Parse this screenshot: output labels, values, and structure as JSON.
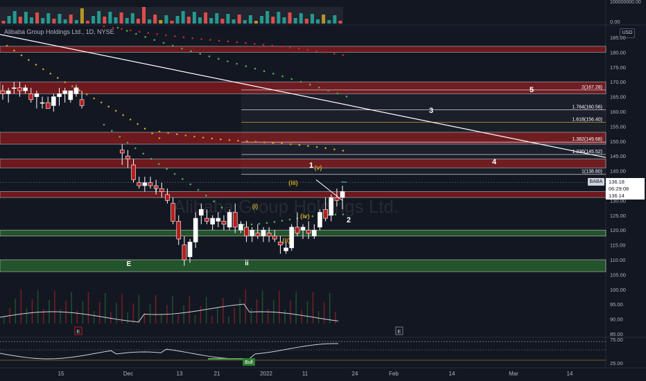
{
  "symbol_legend": "Alibaba Group Holdings Ltd., 1D, NYSE",
  "watermark": "Alibaba Group Holdings Ltd.",
  "watermark_ticker": "BABA",
  "currency": "USD",
  "price_scale": {
    "labels": [
      "185.00",
      "180.00",
      "175.00",
      "170.00",
      "165.00",
      "160.00",
      "155.00",
      "150.00",
      "145.00",
      "140.00",
      "135.00",
      "130.00",
      "125.00",
      "120.00",
      "115.00",
      "110.00",
      "105.00",
      "100.00",
      "95.00",
      "90.00",
      "85.00"
    ],
    "volume_top_label": "100000000.00",
    "volume_bottom_label": "0.00",
    "rsi_labels": [
      "75.00",
      "25.00"
    ]
  },
  "price_tags": {
    "ticker": "BABA",
    "last_price": "136.18",
    "countdown": "06:29:08",
    "second_price": "136.14"
  },
  "time_axis": [
    "15",
    "Dec",
    "13",
    "21",
    "2022",
    "11",
    "24",
    "Feb",
    "14",
    "Mar",
    "14"
  ],
  "fib_levels": [
    "2(167.28)",
    "1.764(160.56)",
    "1.618(156.40)",
    "1.382(149.68)",
    "1.236(145.52)",
    "1(138.80)"
  ],
  "wave_labels": {
    "major": [
      "3",
      "5",
      "4",
      "2",
      "1"
    ],
    "minor": [
      "i",
      "ii",
      "E"
    ],
    "sub": [
      "(i)",
      "(ii)",
      "(iii)",
      "(iv)",
      "(v)"
    ]
  },
  "event_markers": [
    "E",
    "E"
  ],
  "signal_label": "Bull",
  "chart_data": {
    "type": "candlestick",
    "symbol": "BABA",
    "exchange": "NYSE",
    "interval": "1D",
    "ylim": [
      85,
      185
    ],
    "candles": [
      [
        167,
        169,
        164,
        166
      ],
      [
        166,
        168,
        163,
        167
      ],
      [
        168,
        170,
        166,
        168
      ],
      [
        168,
        170,
        165,
        167
      ],
      [
        167,
        169,
        166,
        168
      ],
      [
        166,
        168,
        163,
        164
      ],
      [
        165,
        167,
        161,
        166
      ],
      [
        163,
        165,
        161,
        163
      ],
      [
        163,
        165,
        161,
        161
      ],
      [
        162,
        166,
        160,
        165
      ],
      [
        165,
        168,
        162,
        166
      ],
      [
        166,
        168,
        163,
        167
      ],
      [
        164,
        167,
        163,
        167
      ],
      [
        166,
        169,
        165,
        168
      ],
      [
        164,
        167,
        161,
        162
      ],
      [
        147,
        149,
        142,
        146
      ],
      [
        145,
        147,
        141,
        144
      ],
      [
        142,
        144,
        136,
        137
      ],
      [
        136,
        138,
        134,
        135
      ],
      [
        135,
        138,
        133,
        136
      ],
      [
        136,
        138,
        134,
        135
      ],
      [
        135,
        137,
        132,
        134
      ],
      [
        134,
        136,
        131,
        133
      ],
      [
        132,
        134,
        129,
        130
      ],
      [
        129,
        131,
        122,
        123
      ],
      [
        123,
        125,
        115,
        117
      ],
      [
        115,
        118,
        108,
        110
      ],
      [
        111,
        117,
        109,
        116
      ],
      [
        116,
        126,
        114,
        124
      ],
      [
        125,
        129,
        122,
        127
      ],
      [
        124,
        127,
        122,
        123
      ],
      [
        122,
        125,
        120,
        124
      ],
      [
        123,
        126,
        121,
        124
      ],
      [
        123,
        125,
        120,
        122
      ],
      [
        121,
        127,
        120,
        126
      ],
      [
        126,
        129,
        119,
        121
      ],
      [
        120,
        123,
        119,
        122
      ],
      [
        121,
        123,
        116,
        118
      ],
      [
        118,
        121,
        116,
        120
      ],
      [
        119,
        122,
        117,
        118
      ],
      [
        118,
        121,
        116,
        120
      ],
      [
        119,
        121,
        116,
        118
      ],
      [
        118,
        120,
        116,
        117
      ],
      [
        116,
        118,
        112,
        115
      ],
      [
        113,
        116,
        112,
        114
      ],
      [
        114,
        122,
        113,
        121
      ],
      [
        121,
        126,
        118,
        119
      ],
      [
        120,
        122,
        117,
        121
      ],
      [
        120,
        123,
        117,
        119
      ],
      [
        118,
        122,
        117,
        120
      ],
      [
        121,
        127,
        120,
        126
      ],
      [
        127,
        131,
        123,
        124
      ],
      [
        125,
        132,
        123,
        131
      ],
      [
        131,
        134,
        128,
        130
      ],
      [
        131,
        135,
        127,
        133
      ],
      [
        133,
        138,
        131,
        135
      ],
      [
        136,
        138,
        132,
        132
      ],
      [
        133,
        135,
        130,
        131
      ],
      [
        131,
        133,
        126,
        127
      ],
      [
        128,
        134,
        127,
        133
      ],
      [
        134,
        136,
        133,
        135
      ]
    ],
    "volume_max_label": "100000000.00",
    "overlays": {
      "resistance_zones": [
        [
          180,
          182
        ],
        [
          166,
          170
        ],
        [
          149,
          153
        ],
        [
          141,
          144
        ],
        [
          131,
          133
        ]
      ],
      "support_zones": [
        [
          118,
          120
        ],
        [
          106,
          110
        ]
      ],
      "fibonacci_extension": [
        {
          "ratio": "2",
          "price": 167.28
        },
        {
          "ratio": "1.764",
          "price": 160.56
        },
        {
          "ratio": "1.618",
          "price": 156.4
        },
        {
          "ratio": "1.382",
          "price": 149.68
        },
        {
          "ratio": "1.236",
          "price": 145.52
        },
        {
          "ratio": "1",
          "price": 138.8
        }
      ]
    },
    "indicator_levels": [
      75,
      25
    ]
  },
  "colors": {
    "background": "#131722",
    "up_candle": "#ffffff",
    "down_candle": "#b71c1c",
    "resistance": "#b71c1c",
    "support": "#2e7d32",
    "fib_line": "#d1d4dc",
    "wave_major": "#ffffff",
    "wave_sub": "#c9a227",
    "volume_up": "#26a69a",
    "volume_down": "#ef5350",
    "volume_accent": "#c9a227",
    "dots_green": "#4caf50",
    "dots_red": "#c62828",
    "dots_gold": "#c9a227"
  }
}
